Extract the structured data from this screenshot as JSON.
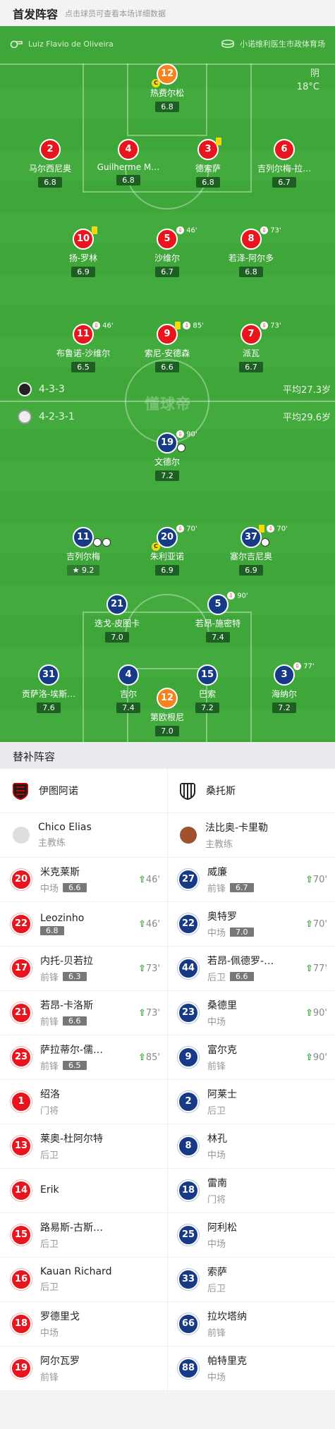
{
  "header": {
    "title": "首发阵容",
    "hint": "点击球员可查看本场详细数据"
  },
  "info": {
    "referee": "Luiz Flavio de Oliveira",
    "stadium": "小诺维利医生市政体育场",
    "weather": "阴",
    "temperature": "18°C"
  },
  "home": {
    "formation": "4-3-3",
    "avg_age": "平均27.3岁",
    "name": "伊图阿诺"
  },
  "away": {
    "formation": "4-2-3-1",
    "avg_age": "平均29.6岁",
    "name": "桑托斯"
  },
  "watermark": "懂球帝",
  "home_players": [
    {
      "num": "12",
      "name": "热费尔松",
      "rating": "6.8"
    },
    {
      "num": "2",
      "name": "马尔西尼奥",
      "rating": "6.8"
    },
    {
      "num": "4",
      "name": "Guilherme M…",
      "rating": "6.8"
    },
    {
      "num": "3",
      "name": "德索萨",
      "rating": "6.8"
    },
    {
      "num": "6",
      "name": "吉列尔梅-拉…",
      "rating": "6.7"
    },
    {
      "num": "10",
      "name": "扬-罗林",
      "rating": "6.9"
    },
    {
      "num": "5",
      "name": "沙维尔",
      "rating": "6.7",
      "sub": "46'"
    },
    {
      "num": "8",
      "name": "若泽-阿尔多",
      "rating": "6.8",
      "sub": "73'"
    },
    {
      "num": "11",
      "name": "布鲁诺-沙维尔",
      "rating": "6.5",
      "sub": "46'"
    },
    {
      "num": "9",
      "name": "索尼-安德森",
      "rating": "6.6",
      "sub": "85'"
    },
    {
      "num": "7",
      "name": "派瓦",
      "rating": "6.7",
      "sub": "73'"
    }
  ],
  "away_players": [
    {
      "num": "19",
      "name": "文德尔",
      "rating": "7.2",
      "sub": "90'"
    },
    {
      "num": "11",
      "name": "吉列尔梅",
      "rating": "9.2"
    },
    {
      "num": "20",
      "name": "朱利亚诺",
      "rating": "6.9",
      "sub": "70'"
    },
    {
      "num": "37",
      "name": "塞尔吉尼奥",
      "rating": "6.9",
      "sub": "70'"
    },
    {
      "num": "21",
      "name": "迭戈-皮图卡",
      "rating": "7.0"
    },
    {
      "num": "5",
      "name": "若昂-施密特",
      "rating": "7.4",
      "sub": "90'"
    },
    {
      "num": "31",
      "name": "贡萨洛-埃斯…",
      "rating": "7.6"
    },
    {
      "num": "4",
      "name": "吉尔",
      "rating": "7.4"
    },
    {
      "num": "15",
      "name": "巴索",
      "rating": "7.2"
    },
    {
      "num": "3",
      "name": "海纳尔",
      "rating": "7.2",
      "sub": "77'"
    },
    {
      "num": "12",
      "name": "第欧根尼",
      "rating": "7.0"
    }
  ],
  "subs_title": "替补阵容",
  "coaches": {
    "home": {
      "name": "Chico Elias",
      "role": "主教练"
    },
    "away": {
      "name": "法比奥-卡里勒",
      "role": "主教练"
    }
  },
  "home_subs": [
    {
      "num": "20",
      "name": "米克莱斯",
      "pos": "中场",
      "rating": "6.6",
      "min": "46'"
    },
    {
      "num": "22",
      "name": "Leozinho",
      "pos": "",
      "rating": "6.8",
      "min": "46'"
    },
    {
      "num": "17",
      "name": "内托-贝若拉",
      "pos": "前锋",
      "rating": "6.3",
      "min": "73'"
    },
    {
      "num": "21",
      "name": "若昂-卡洛斯",
      "pos": "前锋",
      "rating": "6.6",
      "min": "73'"
    },
    {
      "num": "23",
      "name": "萨拉蒂尔-儒…",
      "pos": "前锋",
      "rating": "6.5",
      "min": "85'"
    },
    {
      "num": "1",
      "name": "绍洛",
      "pos": "门将"
    },
    {
      "num": "13",
      "name": "莱奥-杜阿尔特",
      "pos": "后卫"
    },
    {
      "num": "14",
      "name": "Erik",
      "pos": ""
    },
    {
      "num": "15",
      "name": "路易斯-古斯…",
      "pos": "后卫"
    },
    {
      "num": "16",
      "name": "Kauan Richard",
      "pos": "后卫"
    },
    {
      "num": "18",
      "name": "罗德里戈",
      "pos": "中场"
    },
    {
      "num": "19",
      "name": "阿尔瓦罗",
      "pos": "前锋"
    }
  ],
  "away_subs": [
    {
      "num": "27",
      "name": "威廉",
      "pos": "前锋",
      "rating": "6.7",
      "min": "70'"
    },
    {
      "num": "22",
      "name": "奥特罗",
      "pos": "中场",
      "rating": "7.0",
      "min": "70'"
    },
    {
      "num": "44",
      "name": "若昂-佩德罗-…",
      "pos": "后卫",
      "rating": "6.6",
      "min": "77'"
    },
    {
      "num": "23",
      "name": "桑德里",
      "pos": "中场",
      "min": "90'"
    },
    {
      "num": "9",
      "name": "富尔克",
      "pos": "前锋",
      "min": "90'"
    },
    {
      "num": "2",
      "name": "阿莱士",
      "pos": "后卫"
    },
    {
      "num": "8",
      "name": "林孔",
      "pos": "中场"
    },
    {
      "num": "18",
      "name": "雷南",
      "pos": "门将"
    },
    {
      "num": "25",
      "name": "阿利松",
      "pos": "中场"
    },
    {
      "num": "33",
      "name": "索萨",
      "pos": "后卫"
    },
    {
      "num": "66",
      "name": "拉坎塔纳",
      "pos": "前锋"
    },
    {
      "num": "88",
      "name": "帕特里克",
      "pos": "中场"
    }
  ],
  "colors": {
    "pitch": "#3fa63a",
    "home": "#e8141e",
    "away": "#173a86",
    "keeper": "#f7821e"
  }
}
